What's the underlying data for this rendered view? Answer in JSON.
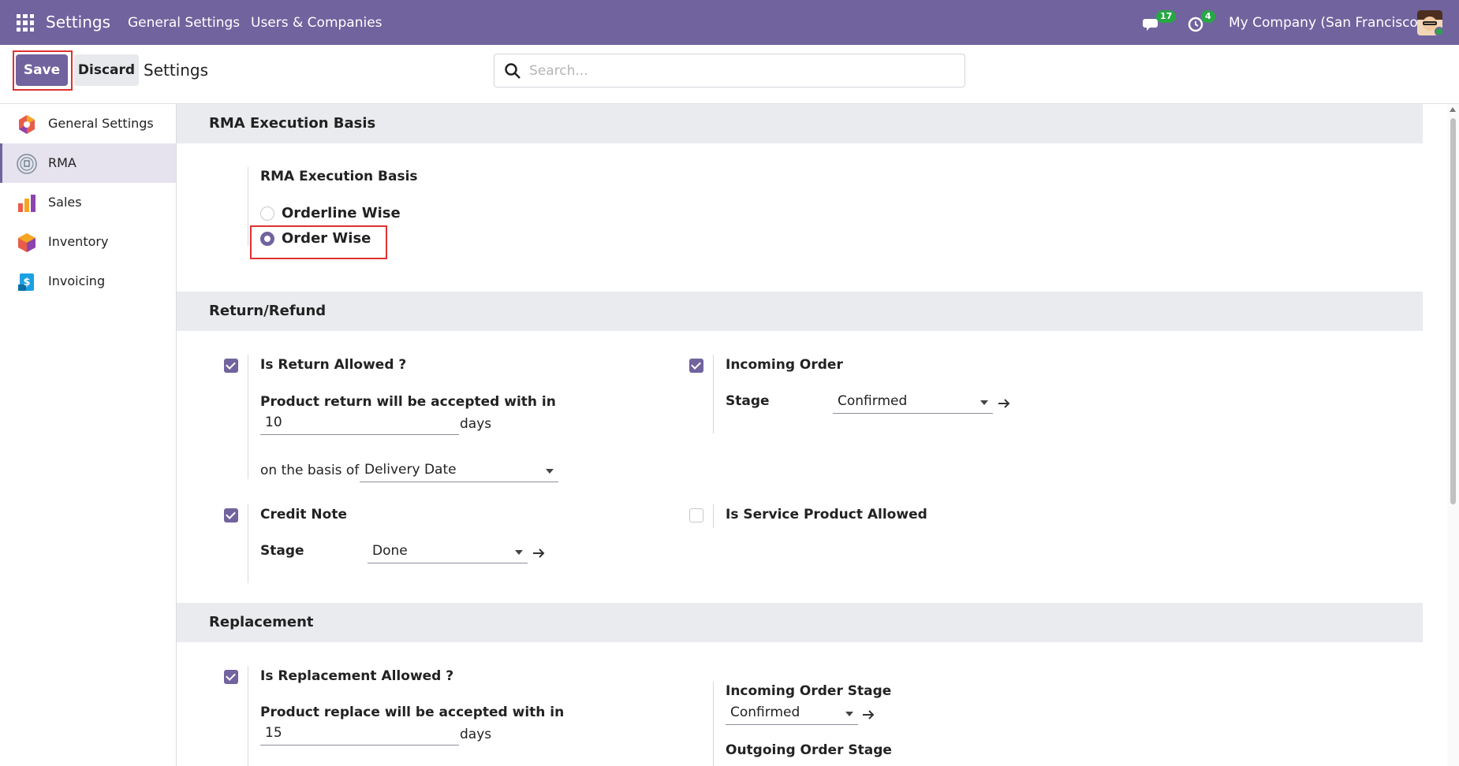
{
  "navbar": {
    "brand": "Settings",
    "menus": [
      "General Settings",
      "Users & Companies"
    ],
    "chat_count": "17",
    "activity_count": "4",
    "company": "My Company (San Francisco)"
  },
  "control": {
    "save_label": "Save",
    "discard_label": "Discard",
    "breadcrumb": "Settings",
    "search_placeholder": "Search..."
  },
  "sidebar": {
    "items": [
      {
        "label": "General Settings",
        "icon": "general-settings-icon",
        "active": false
      },
      {
        "label": "RMA",
        "icon": "rma-icon",
        "active": true
      },
      {
        "label": "Sales",
        "icon": "sales-icon",
        "active": false
      },
      {
        "label": "Inventory",
        "icon": "inventory-icon",
        "active": false
      },
      {
        "label": "Invoicing",
        "icon": "invoicing-icon",
        "active": false
      }
    ]
  },
  "rma_execution": {
    "section_title": "RMA Execution Basis",
    "field_label": "RMA Execution Basis",
    "options": [
      {
        "label": "Orderline Wise",
        "selected": false
      },
      {
        "label": "Order Wise",
        "selected": true
      }
    ]
  },
  "return_refund": {
    "section_title": "Return/Refund",
    "is_return_allowed": {
      "label": "Is Return Allowed ?",
      "checked": true
    },
    "return_window_label": "Product return will be accepted with in",
    "return_days": "10",
    "days_unit": "days",
    "basis_label": "on the basis of",
    "basis_value": "Delivery Date",
    "credit_note": {
      "label": "Credit Note",
      "checked": true
    },
    "credit_stage_label": "Stage",
    "credit_stage_value": "Done",
    "incoming_order": {
      "label": "Incoming Order",
      "checked": true
    },
    "incoming_stage_label": "Stage",
    "incoming_stage_value": "Confirmed",
    "service_product": {
      "label": "Is Service Product Allowed",
      "checked": false
    }
  },
  "replacement": {
    "section_title": "Replacement",
    "is_replacement_allowed": {
      "label": "Is Replacement Allowed ?",
      "checked": true
    },
    "replace_window_label": "Product replace will be accepted with in",
    "replace_days": "15",
    "days_unit": "days",
    "incoming_order_stage_label": "Incoming Order Stage",
    "incoming_order_stage_value": "Confirmed",
    "outgoing_order_stage_label": "Outgoing Order Stage"
  },
  "colors": {
    "brand": "#71639e",
    "highlight": "#e03131",
    "badge": "#28a745"
  }
}
